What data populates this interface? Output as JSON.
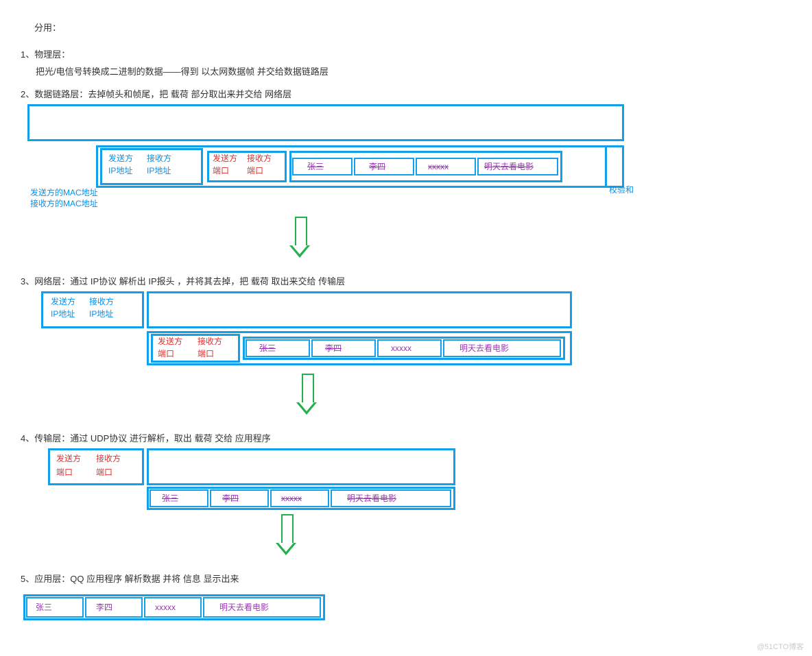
{
  "heading": "分用：",
  "s1": {
    "title": "1、物理层：",
    "desc": "把光/电信号转换成二进制的数据——得到  以太网数据帧  并交给数据链路层"
  },
  "s2": {
    "title": "2、数据链路层：去掉帧头和帧尾，把 载荷 部分取出来并交给 网络层"
  },
  "s3": {
    "title": "3、网络层：通过 IP协议 解析出 IP报头 ，并将其去掉，把 载荷 取出来交给 传输层"
  },
  "s4": {
    "title": "4、传输层：通过 UDP协议 进行解析，取出 载荷 交给 应用程序"
  },
  "s5": {
    "title": "5、应用层：QQ 应用程序 解析数据 并将 信息 显示出来"
  },
  "mac": {
    "send": "发送方的MAC地址",
    "recv": "接收方的MAC地址",
    "check": "校验和"
  },
  "ip": {
    "send1": "发送方",
    "recv1": "接收方",
    "send2": "IP地址",
    "recv2": "IP地址"
  },
  "udp": {
    "send1": "发送方",
    "recv1": "接收方",
    "send2": "端口",
    "recv2": "端口"
  },
  "app": {
    "c1": "张三",
    "c2": "李四",
    "c3": "xxxxx",
    "c4": "明天去看电影"
  },
  "watermark": "@51CTO博客"
}
